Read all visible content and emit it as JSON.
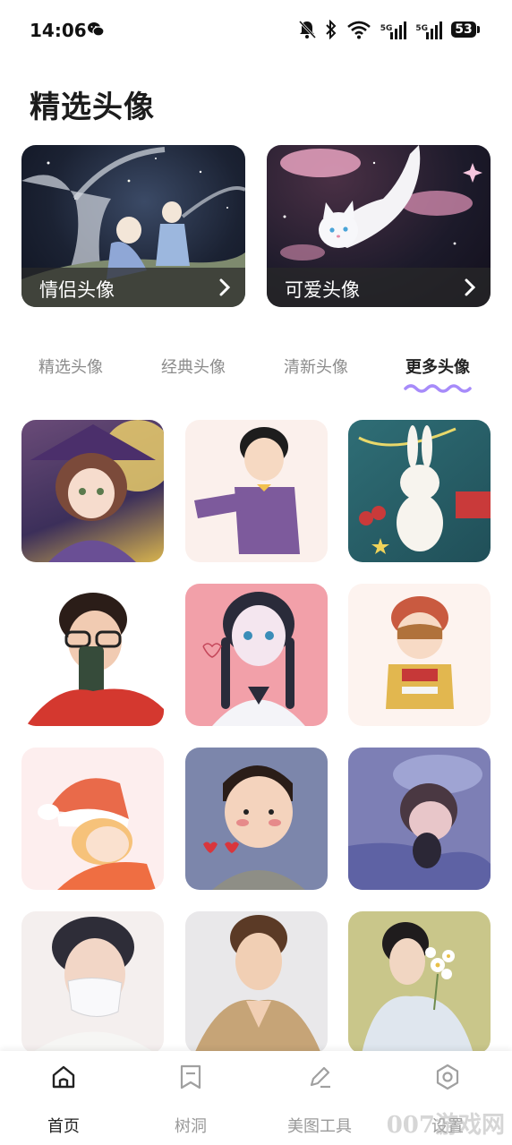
{
  "status_bar": {
    "time": "14:06",
    "icons": [
      "wechat-icon",
      "mute-bell-icon",
      "bluetooth-icon",
      "wifi-icon",
      "signal-5g-icon",
      "signal-5g-icon",
      "battery-icon"
    ],
    "net_label_1": "5G",
    "net_label_2": "5G",
    "battery": "53"
  },
  "page": {
    "title": "精选头像"
  },
  "featured": [
    {
      "label": "情侣头像",
      "icon": "chevron-right-icon"
    },
    {
      "label": "可爱头像",
      "icon": "chevron-right-icon"
    }
  ],
  "tabs": [
    {
      "label": "精选头像",
      "active": false
    },
    {
      "label": "经典头像",
      "active": false
    },
    {
      "label": "清新头像",
      "active": false
    },
    {
      "label": "更多头像",
      "active": true
    }
  ],
  "colors": {
    "accent_wave": "#a78bfa",
    "active_text": "#222222",
    "inactive_text": "#8b8b8b"
  },
  "avatars": [
    "witch-girl-avatar",
    "boy-purple-sweater-avatar",
    "bunny-avatar",
    "boy-phone-selfie-avatar",
    "schoolgirl-braids-avatar",
    "boy-red-hat-avatar",
    "christmas-girl-avatar",
    "boy-blush-avatar",
    "sleeping-child-avatar",
    "masked-boy-avatar",
    "boy-jacket-avatar",
    "boy-flowers-avatar"
  ],
  "bottom_nav": [
    {
      "label": "首页",
      "icon": "home-icon",
      "active": true
    },
    {
      "label": "树洞",
      "icon": "bookmark-icon",
      "active": false
    },
    {
      "label": "美图工具",
      "icon": "pen-icon",
      "active": false
    },
    {
      "label": "设置",
      "icon": "settings-hexagon-icon",
      "active": false
    }
  ],
  "watermark": "007游戏网"
}
